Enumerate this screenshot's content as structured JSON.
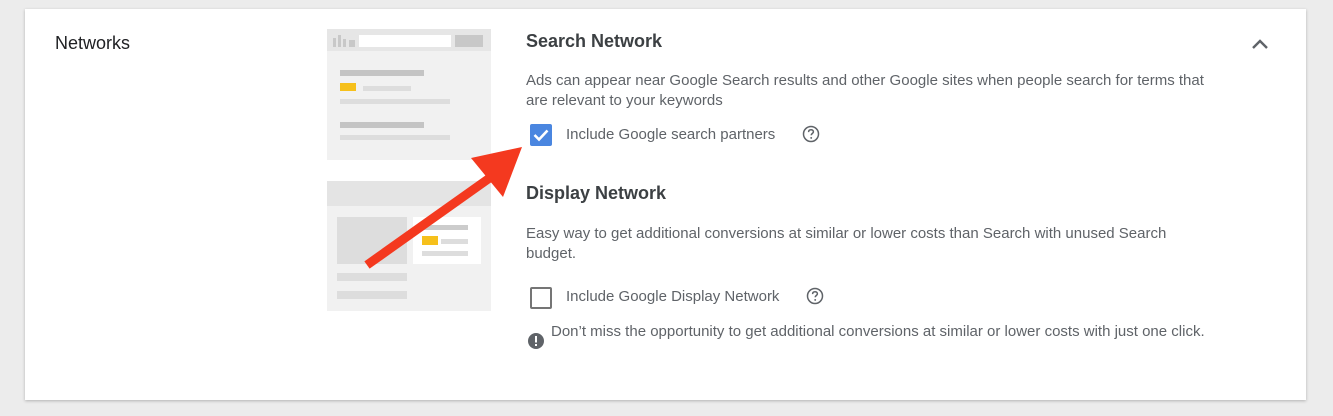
{
  "section": {
    "title": "Networks"
  },
  "search_network": {
    "title": "Search Network",
    "description": "Ads can appear near Google Search results and other Google sites when people search for terms that are relevant to your keywords",
    "checkbox_label": "Include Google search partners",
    "checked": true
  },
  "display_network": {
    "title": "Display Network",
    "description": "Easy way to get additional conversions at similar or lower costs than Search with unused Search budget.",
    "checkbox_label": "Include Google Display Network",
    "checked": false,
    "notice": "Don’t miss the opportunity to get additional conversions at similar or lower costs with just one click."
  },
  "icons": {
    "collapse": "chevron-up-icon",
    "help": "help-circle-icon",
    "alert": "alert-circle-icon",
    "check": "check-icon"
  },
  "colors": {
    "checkbox_checked": "#4a86e0",
    "arrow": "#f4391f",
    "illustration_yellow": "#f6c01b"
  }
}
